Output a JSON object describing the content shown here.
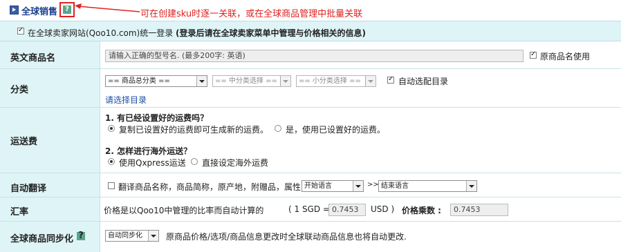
{
  "section": {
    "title": "全球销售",
    "help_glyph": "?",
    "annotation": "可在创建sku时逐一关联，或在全球商品管理中批量关联"
  },
  "login": {
    "text": "在全球卖家网站(Qoo10.com)统一登录",
    "bold": "(登录后请在全球卖家菜单中管理与价格相关的信息)"
  },
  "english_name": {
    "label": "英文商品名",
    "placeholder": "请输入正确的型号名. (最多200字: 英语)",
    "use_original_label": "原商品名使用"
  },
  "category": {
    "label": "分类",
    "large": "== 商品总分类 ==",
    "medium": "== 中分类选择 ==",
    "small": "== 小分类选择 ==",
    "auto_label": "自动选配目录",
    "select_link": "请选择目录"
  },
  "shipping": {
    "label": "运送费",
    "q1": "1. 有已经设置好的运费吗？",
    "q1_opt1": "复制已设置好的运费即可生成新的运费。",
    "q1_opt2": "是，使用已设置好的运费。",
    "q2": "2. 怎样进行海外运送？",
    "q2_opt1": "使用Qxpress运送",
    "q2_opt2": "直接设定海外运费"
  },
  "translate": {
    "label": "自动翻译",
    "text": "翻译商品名称，商品简称，原产地，附赠品，属性",
    "start_lang": "开始语言",
    "arrow": ">>",
    "end_lang": "结束语言"
  },
  "rate": {
    "label": "汇率",
    "text": "价格是以Qoo10中管理的比率而自动计算的",
    "sgd_prefix": "( 1  SGD =",
    "sgd_value": "0.7453",
    "sgd_suffix": "USD )",
    "multiplier_label": "价格乘数 :",
    "multiplier_value": "0.7453"
  },
  "sync": {
    "label": "全球商品同步化",
    "select": "自动同步化",
    "text": "原商品价格/选项/商品信息更改时全球联动商品信息也将自动更改."
  },
  "colors": {
    "label_bg": "#dff4f7",
    "title_blue": "#1b3f8b",
    "annotation_red": "#e02020",
    "link_blue": "#1d4ea3"
  }
}
